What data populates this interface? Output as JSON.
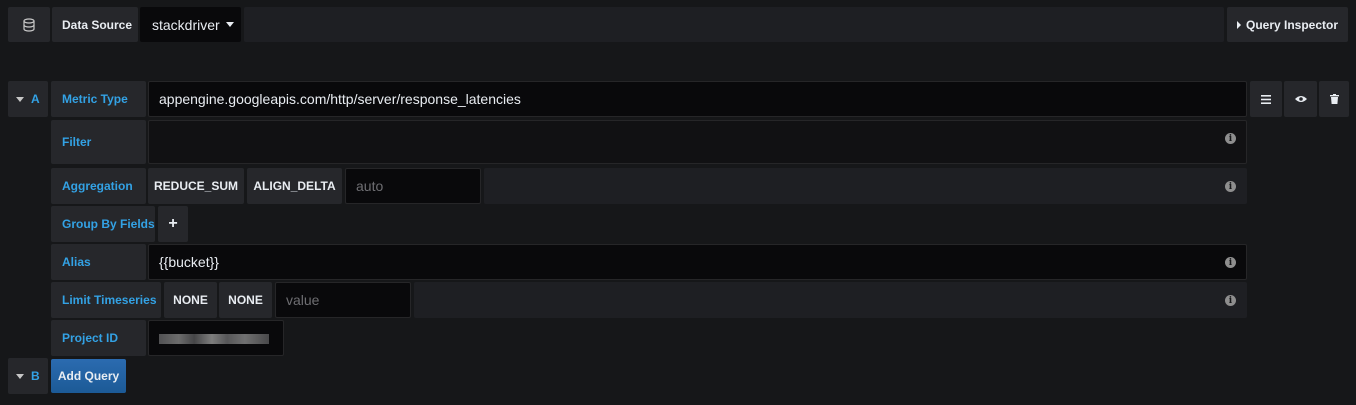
{
  "header": {
    "datasource_label": "Data Source",
    "datasource_value": "stackdriver",
    "query_inspector_label": "Query Inspector"
  },
  "query_a": {
    "letter": "A",
    "metric_type": {
      "label": "Metric Type",
      "value": "appengine.googleapis.com/http/server/response_latencies"
    },
    "filter": {
      "label": "Filter",
      "value": ""
    },
    "aggregation": {
      "label": "Aggregation",
      "reducer": "REDUCE_SUM",
      "aligner": "ALIGN_DELTA",
      "period_placeholder": "auto"
    },
    "group_by": {
      "label": "Group By Fields",
      "add_glyph": "+"
    },
    "alias": {
      "label": "Alias",
      "value": "{{bucket}}"
    },
    "limit_timeseries": {
      "label": "Limit Timeseries",
      "option1": "NONE",
      "option2": "NONE",
      "value_placeholder": "value"
    },
    "project_id": {
      "label": "Project ID"
    },
    "info_glyph": "i",
    "actions": [
      "menu-icon",
      "eye-icon",
      "trash-icon"
    ]
  },
  "query_b": {
    "letter": "B",
    "add_query_label": "Add Query"
  },
  "colors": {
    "background": "#161719",
    "cell": "#26272b",
    "input": "#09090b",
    "label_blue": "#33a2e5",
    "add_query_button": "#1f60c4"
  }
}
